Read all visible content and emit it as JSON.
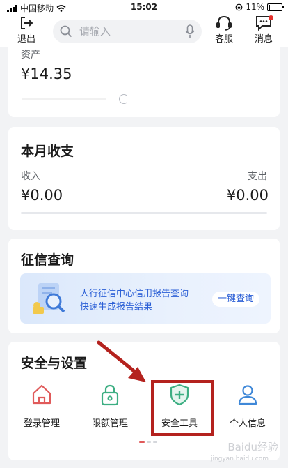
{
  "status_bar": {
    "carrier": "中国移动",
    "time": "15:02",
    "battery_pct": "11%",
    "battery_level": 0.11
  },
  "top_bar": {
    "logout_label": "退出",
    "search_placeholder": "请输入",
    "service_label": "客服",
    "message_label": "消息"
  },
  "asset_card": {
    "label": "资产",
    "value": "¥14.35"
  },
  "monthly_card": {
    "title": "本月收支",
    "income_label": "收入",
    "expense_label": "支出",
    "income_value": "¥0.00",
    "expense_value": "¥0.00"
  },
  "credit_card": {
    "title": "征信查询",
    "banner_line1": "人行征信中心信用报告查询",
    "banner_line2": "快速生成报告结果",
    "banner_button": "一键查询"
  },
  "security_card": {
    "title": "安全与设置",
    "tools": [
      {
        "label": "登录管理",
        "icon": "home-icon"
      },
      {
        "label": "限额管理",
        "icon": "lock-icon"
      },
      {
        "label": "安全工具",
        "icon": "shield-plus-icon"
      },
      {
        "label": "个人信息",
        "icon": "person-icon"
      }
    ]
  },
  "colors": {
    "accent_red": "#e05a5a",
    "accent_green": "#3cae82",
    "accent_blue": "#3f88d8",
    "annotation_red": "#b4221e"
  },
  "watermark": {
    "text": "Baidu经验",
    "sub": "jingyan.baidu.com"
  }
}
